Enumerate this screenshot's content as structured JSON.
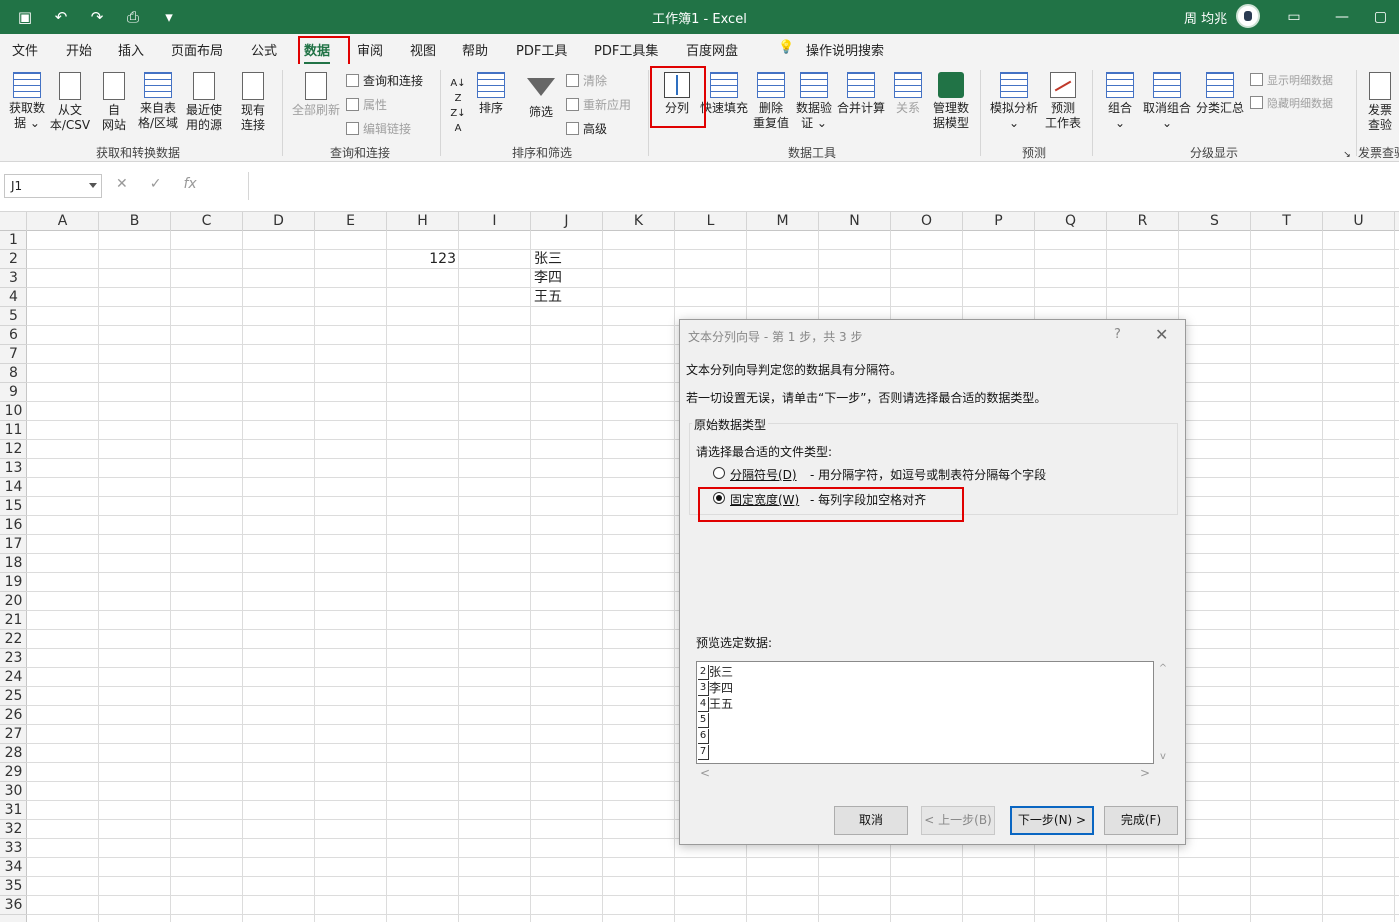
{
  "window": {
    "title": "工作簿1 - Excel",
    "user": "周 均兆"
  },
  "qat": {
    "save": "save-icon",
    "undo": "undo-icon",
    "redo": "redo-icon",
    "preview": "print-preview-icon",
    "customize": "customize-icon"
  },
  "menu": {
    "tabs": [
      "文件",
      "开始",
      "插入",
      "页面布局",
      "公式",
      "数据",
      "审阅",
      "视图",
      "帮助",
      "PDF工具",
      "PDF工具集",
      "百度网盘"
    ],
    "active": "数据",
    "tell_me": "操作说明搜索"
  },
  "ribbon": {
    "get": {
      "b1": "获取数\n据 ⌄",
      "b2": "从文\n本/CSV",
      "b3": "自\n网站",
      "b4": "来自表\n格/区域",
      "b5": "最近使\n用的源",
      "b6": "现有\n连接",
      "label": "获取和转换数据"
    },
    "query": {
      "refresh": "全部刷新",
      "s1": "查询和连接",
      "s2": "属性",
      "s3": "编辑链接",
      "label": "查询和连接"
    },
    "sort": {
      "sort": "排序",
      "filter": "筛选",
      "s1": "清除",
      "s2": "重新应用",
      "s3": "高级",
      "label": "排序和筛选"
    },
    "tools": {
      "b1": "分列",
      "b2": "快速填充",
      "b3": "删除\n重复值",
      "b4": "数据验\n证 ⌄",
      "b5": "合并计算",
      "b6": "关系",
      "b7": "管理数\n据模型",
      "label": "数据工具"
    },
    "forecast": {
      "b1": "模拟分析\n⌄",
      "b2": "预测\n工作表",
      "label": "预测"
    },
    "outline": {
      "b1": "组合\n⌄",
      "b2": "取消组合\n⌄",
      "b3": "分类汇总",
      "s1": "显示明细数据",
      "s2": "隐藏明细数据",
      "label": "分级显示"
    },
    "invoice": {
      "b1": "发票\n查验",
      "label": "发票查验"
    }
  },
  "formula_bar": {
    "name_box": "J1",
    "cancel": "✕",
    "enter": "✓",
    "fx": "fx",
    "formula": ""
  },
  "columns": [
    "A",
    "B",
    "C",
    "D",
    "E",
    "H",
    "I",
    "J",
    "K",
    "L",
    "M",
    "N",
    "O",
    "P",
    "Q",
    "R",
    "S",
    "T",
    "U"
  ],
  "rows": [
    "1",
    "2",
    "3",
    "4",
    "5",
    "6",
    "7",
    "8",
    "9",
    "10",
    "11",
    "12",
    "13",
    "14",
    "15",
    "16",
    "17",
    "18",
    "19",
    "20",
    "21",
    "22",
    "23",
    "24",
    "25",
    "26",
    "27",
    "28",
    "29",
    "30",
    "31",
    "32",
    "33",
    "34",
    "35",
    "36"
  ],
  "cells": {
    "H2": "123",
    "J2": "张三",
    "J3": "李四",
    "J4": "王五"
  },
  "dialog": {
    "title": "文本分列向导 - 第 1 步，共 3 步",
    "help": "?",
    "close": "✕",
    "line1": "文本分列向导判定您的数据具有分隔符。",
    "line2": "若一切设置无误，请单击“下一步”，否则请选择最合适的数据类型。",
    "group_title": "原始数据类型",
    "prompt": "请选择最合适的文件类型:",
    "opt1_label": "分隔符号(D)",
    "opt1_desc": "- 用分隔字符，如逗号或制表符分隔每个字段",
    "opt2_label": "固定宽度(W)",
    "opt2_desc": "- 每列字段加空格对齐",
    "selected": "固定宽度(W)",
    "preview_title": "预览选定数据:",
    "preview_rows": [
      {
        "n": "2",
        "v": "张三"
      },
      {
        "n": "3",
        "v": "李四"
      },
      {
        "n": "4",
        "v": "王五"
      },
      {
        "n": "5",
        "v": ""
      },
      {
        "n": "6",
        "v": ""
      },
      {
        "n": "7",
        "v": ""
      }
    ],
    "scroll_up": "^",
    "scroll_down": "v",
    "scroll_left": "<",
    "scroll_right": ">",
    "cancel": "取消",
    "back": "< 上一步(B)",
    "next": "下一步(N) >",
    "finish": "完成(F)"
  },
  "colors": {
    "excel_green": "#217346",
    "highlight_red": "#e00000",
    "dialog_bg": "#f0f0f0"
  }
}
